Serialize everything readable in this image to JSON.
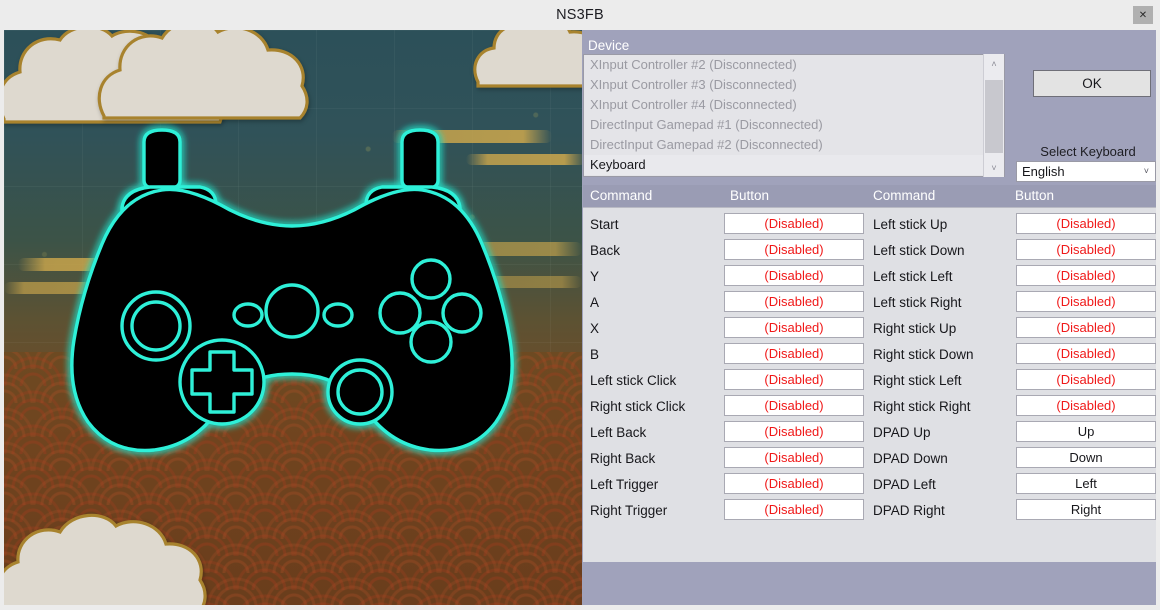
{
  "window": {
    "title": "NS3FB",
    "close_label": "✕"
  },
  "device": {
    "group_label": "Device",
    "items": [
      {
        "label": "XInput Controller #2 (Disconnected)",
        "selected": false
      },
      {
        "label": "XInput Controller #3 (Disconnected)",
        "selected": false
      },
      {
        "label": "XInput Controller #4 (Disconnected)",
        "selected": false
      },
      {
        "label": "DirectInput Gamepad #1 (Disconnected)",
        "selected": false
      },
      {
        "label": "DirectInput Gamepad #2 (Disconnected)",
        "selected": false
      },
      {
        "label": "Keyboard",
        "selected": true
      }
    ],
    "scroll_up_icon": "˄",
    "scroll_down_icon": "˅"
  },
  "keyboard_layout": {
    "label": "Select Keyboard Layout",
    "value": "English",
    "caret_icon": "˅",
    "options": [
      "English"
    ]
  },
  "table": {
    "headers": {
      "command_left": "Command",
      "button_left": "Button",
      "command_right": "Command",
      "button_right": "Button"
    },
    "disabled_text": "(Disabled)",
    "rows": [
      {
        "cmd_left": "Start",
        "btn_left": "(Disabled)",
        "cmd_right": "Left stick Up",
        "btn_right": "(Disabled)"
      },
      {
        "cmd_left": "Back",
        "btn_left": "(Disabled)",
        "cmd_right": "Left stick Down",
        "btn_right": "(Disabled)"
      },
      {
        "cmd_left": "Y",
        "btn_left": "(Disabled)",
        "cmd_right": "Left stick Left",
        "btn_right": "(Disabled)"
      },
      {
        "cmd_left": "A",
        "btn_left": "(Disabled)",
        "cmd_right": "Left stick Right",
        "btn_right": "(Disabled)"
      },
      {
        "cmd_left": "X",
        "btn_left": "(Disabled)",
        "cmd_right": "Right stick Up",
        "btn_right": "(Disabled)"
      },
      {
        "cmd_left": "B",
        "btn_left": "(Disabled)",
        "cmd_right": "Right stick Down",
        "btn_right": "(Disabled)"
      },
      {
        "cmd_left": "Left stick Click",
        "btn_left": "(Disabled)",
        "cmd_right": "Right stick Left",
        "btn_right": "(Disabled)"
      },
      {
        "cmd_left": "Right stick Click",
        "btn_left": "(Disabled)",
        "cmd_right": "Right stick Right",
        "btn_right": "(Disabled)"
      },
      {
        "cmd_left": "Left Back",
        "btn_left": "(Disabled)",
        "cmd_right": "DPAD Up",
        "btn_right": "Up"
      },
      {
        "cmd_left": "Right Back",
        "btn_left": "(Disabled)",
        "cmd_right": "DPAD Down",
        "btn_right": "Down"
      },
      {
        "cmd_left": "Left Trigger",
        "btn_left": "(Disabled)",
        "cmd_right": "DPAD Left",
        "btn_right": "Left"
      },
      {
        "cmd_left": "Right Trigger",
        "btn_left": "(Disabled)",
        "cmd_right": "DPAD Right",
        "btn_right": "Right"
      }
    ]
  },
  "footer": {
    "ok_label": "OK"
  },
  "artwork": {
    "description": "Cyan neon gamepad outline over Japanese cloud and wave artwork",
    "gamepad_outline_color": "#2ff0d8",
    "gamepad_fill_color": "#000000",
    "cloud_color": "#ded9cf",
    "cloud_edge_color": "#a8832e"
  },
  "colors": {
    "panel": "#a0a2bb",
    "table_header": "#9a9cb4",
    "table_body": "#dfe0e4",
    "titlebar": "#ececec",
    "disabled_value": "#f01818",
    "bound_value": "#17171b"
  }
}
